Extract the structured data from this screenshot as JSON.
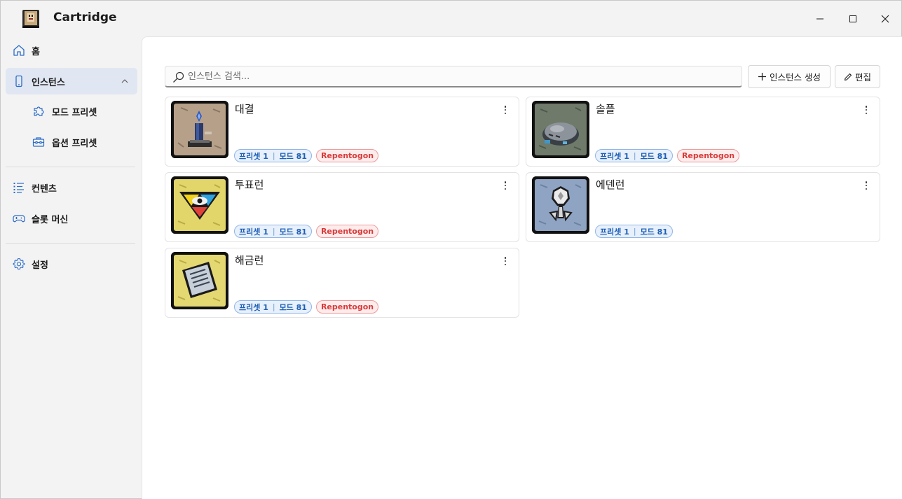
{
  "window": {
    "title": "Cartridge",
    "controls": {
      "minimize": "minimize-icon",
      "maximize": "maximize-icon",
      "close": "close-icon"
    }
  },
  "sidebar": {
    "items": [
      {
        "label": "홈",
        "icon": "home-icon"
      },
      {
        "label": "인스턴스",
        "icon": "phone-icon",
        "active": true,
        "expanded": true
      },
      {
        "label": "모드 프리셋",
        "icon": "puzzle-icon",
        "sub": true
      },
      {
        "label": "옵션 프리셋",
        "icon": "toolbox-icon",
        "sub": true
      },
      {
        "label": "컨텐츠",
        "icon": "list-icon"
      },
      {
        "label": "슬롯 머신",
        "icon": "gamepad-icon"
      },
      {
        "label": "설정",
        "icon": "gear-icon"
      }
    ]
  },
  "toolbar": {
    "search_placeholder": "인스턴스 검색...",
    "create_label": "인스턴스 생성",
    "edit_label": "편집"
  },
  "instances": [
    {
      "name": "대결",
      "preset": "프리셋 1",
      "mods": "모드 81",
      "tag": "Repentogon",
      "thumb": "candle"
    },
    {
      "name": "솔플",
      "preset": "프리셋 1",
      "mods": "모드 81",
      "tag": "Repentogon",
      "thumb": "sleeping-blob"
    },
    {
      "name": "투표런",
      "preset": "프리셋 1",
      "mods": "모드 81",
      "tag": "Repentogon",
      "thumb": "eye-triangle"
    },
    {
      "name": "에덴런",
      "preset": "프리셋 1",
      "mods": "모드 81",
      "tag": "",
      "thumb": "white-flower"
    },
    {
      "name": "해금런",
      "preset": "프리셋 1",
      "mods": "모드 81",
      "tag": "Repentogon",
      "thumb": "paper-note"
    }
  ],
  "colors": {
    "accent": "#1d5fb6",
    "badge_red": "#d93a3a",
    "sidebar_active": "#e1e7f2"
  }
}
